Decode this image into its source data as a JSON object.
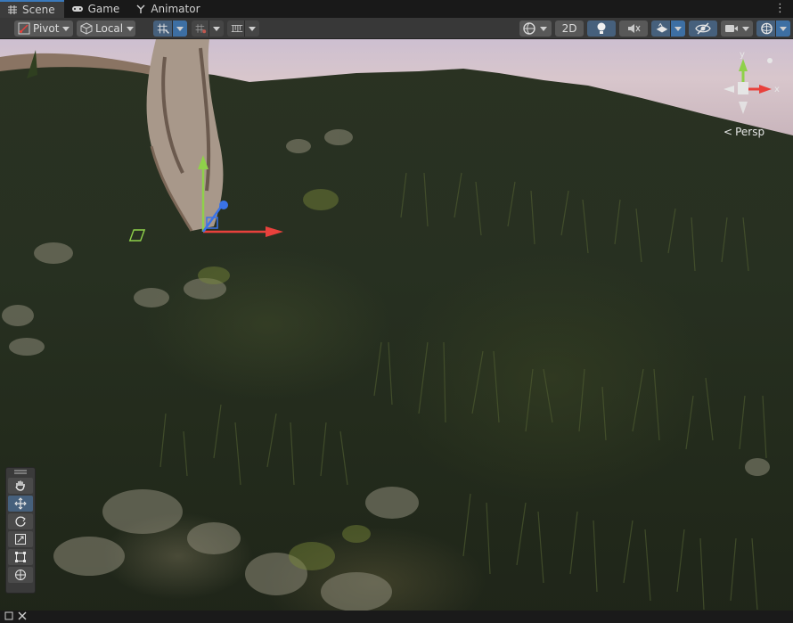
{
  "tabs": [
    {
      "label": "Scene",
      "icon": "scene-grid-icon",
      "active": true
    },
    {
      "label": "Game",
      "icon": "gamepad-icon",
      "active": false
    },
    {
      "label": "Animator",
      "icon": "animator-icon",
      "active": false
    }
  ],
  "tab_more_icon": "vertical-ellipsis-icon",
  "toolbar": {
    "pivot_label": "Pivot",
    "local_label": "Local",
    "mode_2d_label": "2D",
    "icons": [
      "pivot-icon",
      "local-cube-icon",
      "grid-snap-icon",
      "increment-snap-icon",
      "ruler-snap-icon",
      "shading-mode-icon",
      "lighting-icon",
      "audio-mute-icon",
      "effects-icon",
      "scene-visibility-icon",
      "camera-icon",
      "gizmos-icon"
    ]
  },
  "scene": {
    "projection_label": "Persp",
    "orientation_axes": [
      "y",
      "x"
    ],
    "colors": {
      "x_axis": "#e8413c",
      "y_axis": "#8fd14a",
      "z_axis": "#3a73e8",
      "selection": "#3a79bb"
    }
  },
  "tool_palette": {
    "tools": [
      {
        "name": "hand-tool",
        "icon": "hand-icon",
        "active": false
      },
      {
        "name": "move-tool",
        "icon": "move-arrows-icon",
        "active": true
      },
      {
        "name": "rotate-tool",
        "icon": "rotate-icon",
        "active": false
      },
      {
        "name": "scale-tool",
        "icon": "scale-icon",
        "active": false
      },
      {
        "name": "rect-tool",
        "icon": "rect-transform-icon",
        "active": false
      },
      {
        "name": "transform-tool",
        "icon": "transform-icon",
        "active": false
      }
    ]
  },
  "bottom": {
    "icons": [
      "maximize-icon",
      "close-icon"
    ]
  }
}
